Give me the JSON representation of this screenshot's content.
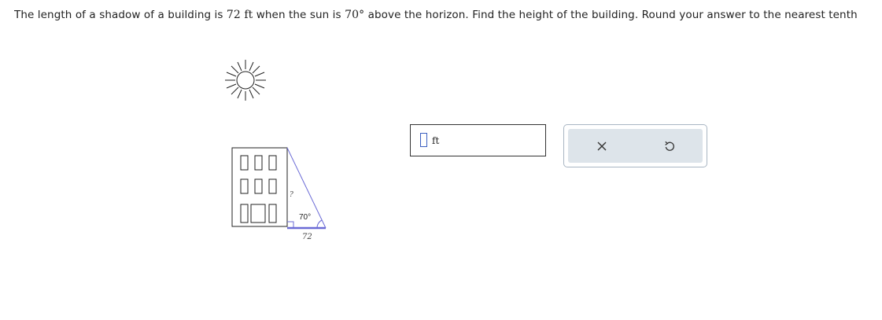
{
  "question": {
    "part1": "The length of a shadow of a building is ",
    "shadow_length": "72",
    "unit_ft": "ft",
    "part2": " when the sun is ",
    "angle": "70°",
    "part3": " above the horizon. Find the height of the building. Round your answer to the nearest tenth"
  },
  "figure": {
    "unknown_label": "?",
    "angle_label": "70°",
    "shadow_label": "72"
  },
  "answer": {
    "value": "",
    "unit": "ft"
  },
  "tools": {
    "clear_icon": "close-icon",
    "undo_icon": "undo-icon"
  },
  "colors": {
    "triangle_line": "#6b6bd6",
    "input_border": "#3b5fc0",
    "tools_bg": "#dde4ea",
    "tools_border": "#a9b6c3"
  }
}
